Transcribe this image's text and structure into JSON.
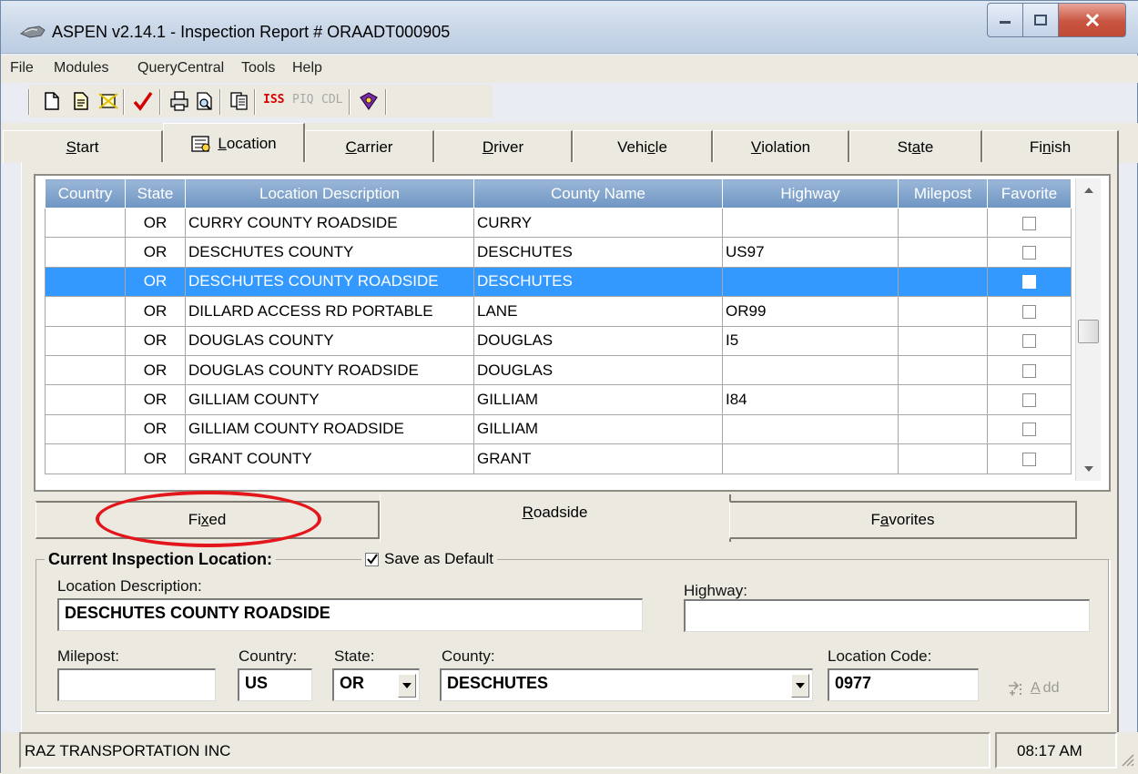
{
  "window": {
    "title": "ASPEN v2.14.1 - Inspection Report # ORAADT000905"
  },
  "menu": [
    "File",
    "Modules",
    "QueryCentral",
    "Tools",
    "Help"
  ],
  "toolbar": {
    "iss_label": "ISS",
    "piq_label": "PIQ",
    "cdl_label": "CDL"
  },
  "tabs": [
    {
      "pre": "",
      "key": "S",
      "post": "tart",
      "active": false
    },
    {
      "pre": "",
      "key": "L",
      "post": "ocation",
      "active": true
    },
    {
      "pre": "",
      "key": "C",
      "post": "arrier",
      "active": false
    },
    {
      "pre": "",
      "key": "D",
      "post": "river",
      "active": false
    },
    {
      "pre": "Vehi",
      "key": "c",
      "post": "le",
      "active": false
    },
    {
      "pre": "",
      "key": "V",
      "post": "iolation",
      "active": false
    },
    {
      "pre": "St",
      "key": "a",
      "post": "te",
      "active": false
    },
    {
      "pre": "Fi",
      "key": "n",
      "post": "ish",
      "active": false
    }
  ],
  "grid": {
    "columns": [
      "Country",
      "State",
      "Location Description",
      "County Name",
      "Highway",
      "Milepost",
      "Favorite"
    ],
    "rows": [
      {
        "country": "",
        "state": "OR",
        "desc": "CURRY COUNTY ROADSIDE",
        "county": "CURRY",
        "highway": "",
        "milepost": "",
        "favorite": false,
        "selected": false
      },
      {
        "country": "",
        "state": "OR",
        "desc": "DESCHUTES COUNTY",
        "county": "DESCHUTES",
        "highway": "US97",
        "milepost": "",
        "favorite": false,
        "selected": false
      },
      {
        "country": "",
        "state": "OR",
        "desc": "DESCHUTES COUNTY ROADSIDE",
        "county": "DESCHUTES",
        "highway": "",
        "milepost": "",
        "favorite": false,
        "selected": true
      },
      {
        "country": "",
        "state": "OR",
        "desc": "DILLARD ACCESS RD PORTABLE",
        "county": "LANE",
        "highway": "OR99",
        "milepost": "",
        "favorite": false,
        "selected": false
      },
      {
        "country": "",
        "state": "OR",
        "desc": "DOUGLAS COUNTY",
        "county": "DOUGLAS",
        "highway": "I5",
        "milepost": "",
        "favorite": false,
        "selected": false
      },
      {
        "country": "",
        "state": "OR",
        "desc": "DOUGLAS COUNTY ROADSIDE",
        "county": "DOUGLAS",
        "highway": "",
        "milepost": "",
        "favorite": false,
        "selected": false
      },
      {
        "country": "",
        "state": "OR",
        "desc": "GILLIAM COUNTY",
        "county": "GILLIAM",
        "highway": "I84",
        "milepost": "",
        "favorite": false,
        "selected": false
      },
      {
        "country": "",
        "state": "OR",
        "desc": "GILLIAM COUNTY ROADSIDE",
        "county": "GILLIAM",
        "highway": "",
        "milepost": "",
        "favorite": false,
        "selected": false
      },
      {
        "country": "",
        "state": "OR",
        "desc": "GRANT COUNTY",
        "county": "GRANT",
        "highway": "",
        "milepost": "",
        "favorite": false,
        "selected": false
      }
    ]
  },
  "subtabs": {
    "fixed": {
      "pre": "Fi",
      "key": "x",
      "post": "ed"
    },
    "roadside": {
      "pre": "",
      "key": "R",
      "post": "oadside"
    },
    "favorites": {
      "pre": "F",
      "key": "a",
      "post": "vorites"
    }
  },
  "current_location": {
    "group_title": "Current Inspection Location:",
    "save_default_label": "Save as Default",
    "save_default_checked": true,
    "location_description_label": "Location Description:",
    "location_description_value": "DESCHUTES COUNTY ROADSIDE",
    "highway_label": "Highway:",
    "highway_value": "",
    "milepost_label": "Milepost:",
    "milepost_value": "",
    "country_label": "Country:",
    "country_value": "US",
    "state_label": "State:",
    "state_value": "OR",
    "county_label": "County:",
    "county_value": "DESCHUTES",
    "location_code_label": "Location Code:",
    "location_code_value": "0977",
    "add_pre": "",
    "add_key": "A",
    "add_post": "dd"
  },
  "status": {
    "left": "RAZ TRANSPORTATION INC",
    "time": "08:17 AM"
  },
  "colors": {
    "selection": "#3399ff",
    "header": "#7fa2cc",
    "annotation": "#e3161b"
  }
}
